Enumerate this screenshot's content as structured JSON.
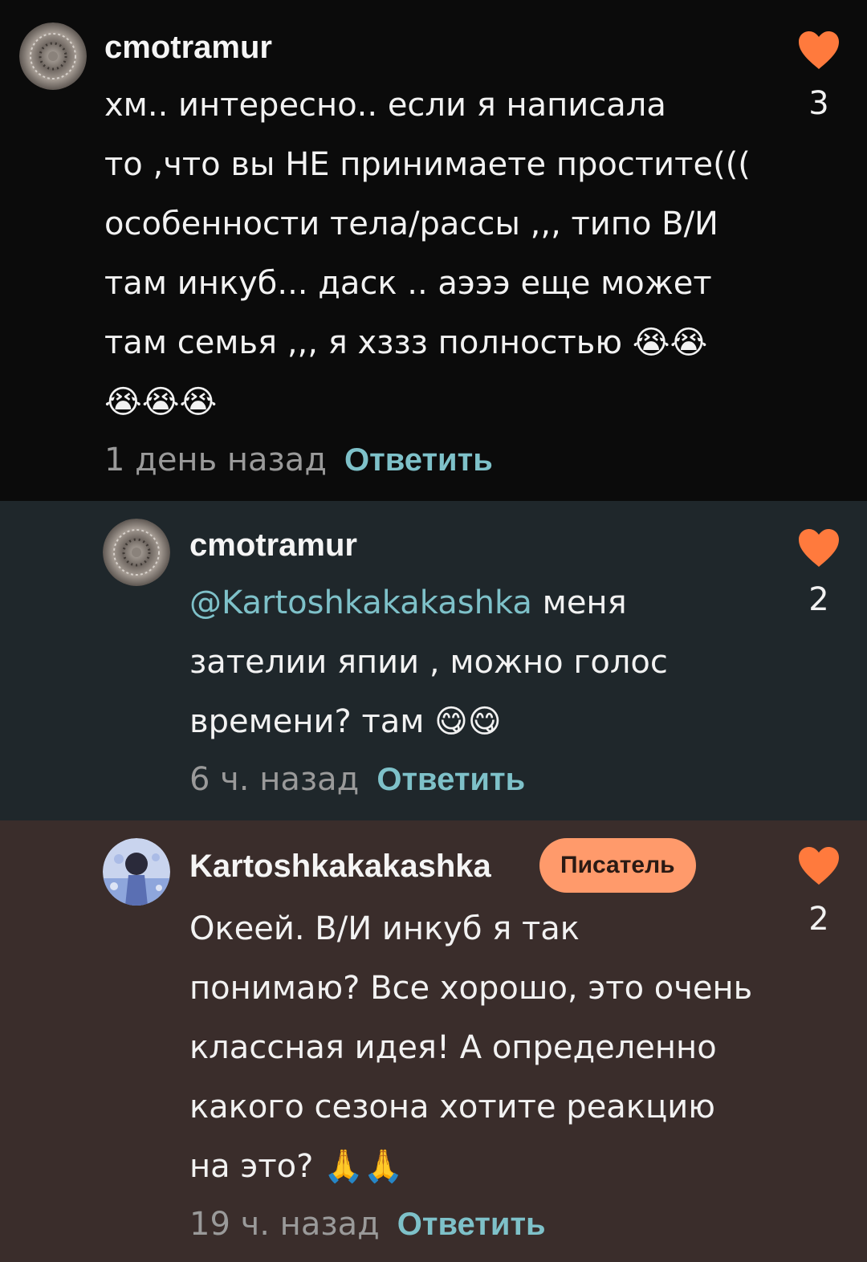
{
  "colors": {
    "accent": "#7ec1c9",
    "heart": "#ff7a3d",
    "badge": "#ff9a6b"
  },
  "comments": [
    {
      "username": "cmotramur",
      "avatar_icon": "avatar-image",
      "text_lines": [
        "хм.. интересно.. если я написала",
        "то ,что вы НЕ принимаете простите(((",
        "особенности тела/рассы ,,, типо В/И",
        "там инкуб... даск .. аэээ еще может",
        "там семья ,,, я хззз полностью 😭😭",
        "😭😭😭"
      ],
      "time": "1 день назад",
      "reply_label": "Ответить",
      "likes": "3"
    },
    {
      "username": "cmotramur",
      "avatar_icon": "avatar-image",
      "mention": "@Kartoshkakakashka",
      "text_line1_rest": " меня",
      "text_lines_rest": [
        "зателии япии , можно голос",
        "времени? там 😋😋"
      ],
      "time": "6 ч. назад",
      "reply_label": "Ответить",
      "likes": "2"
    },
    {
      "username": "Kartoshkakakashka",
      "badge": "Писатель",
      "avatar_icon": "avatar-image",
      "text_lines": [
        "Океей. В/И инкуб я так",
        "понимаю? Все хорошо, это очень",
        "классная идея! А определенно",
        "какого сезона хотите реакцию",
        "на это? 🙏🙏"
      ],
      "time": "19 ч. назад",
      "reply_label": "Ответить",
      "likes": "2"
    }
  ]
}
